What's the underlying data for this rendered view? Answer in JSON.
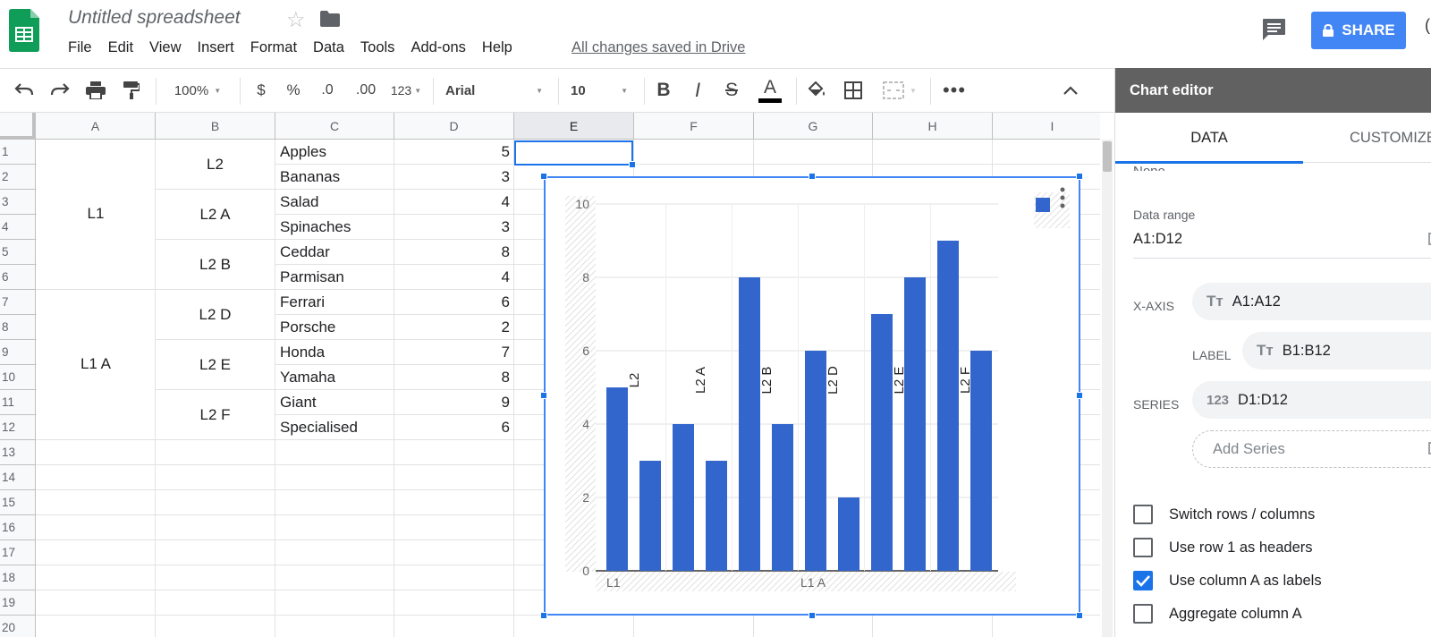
{
  "header": {
    "doc_title": "Untitled spreadsheet",
    "menu": [
      "File",
      "Edit",
      "View",
      "Insert",
      "Format",
      "Data",
      "Tools",
      "Add-ons",
      "Help"
    ],
    "saved_status": "All changes saved in Drive",
    "share_label": "SHARE"
  },
  "toolbar": {
    "zoom": "100%",
    "currency": "$",
    "percent": "%",
    "decrease_decimals": ".0",
    "increase_decimals": ".00",
    "more_formats": "123",
    "font": "Arial",
    "font_size": "10",
    "bold": "B",
    "italic": "I",
    "strikethrough": "S",
    "text_color": "A"
  },
  "grid": {
    "columns": [
      "A",
      "B",
      "C",
      "D",
      "E",
      "F",
      "G",
      "H",
      "I"
    ],
    "rows": [
      "1",
      "2",
      "3",
      "4",
      "5",
      "6",
      "7",
      "8",
      "9",
      "10",
      "11",
      "12",
      "13",
      "14",
      "15",
      "16",
      "17",
      "18",
      "19",
      "20"
    ],
    "col_a_groups": [
      "L1",
      "L1 A"
    ],
    "col_b_groups": [
      "L2",
      "L2 A",
      "L2 B",
      "L2 D",
      "L2 E",
      "L2 F"
    ],
    "col_c": [
      "Apples",
      "Bananas",
      "Salad",
      "Spinaches",
      "Ceddar",
      "Parmisan",
      "Ferrari",
      "Porsche",
      "Honda",
      "Yamaha",
      "Giant",
      "Specialised"
    ],
    "col_d": [
      "5",
      "3",
      "4",
      "3",
      "8",
      "4",
      "6",
      "2",
      "7",
      "8",
      "9",
      "6"
    ]
  },
  "chart_data": {
    "type": "bar",
    "categories": [
      "Apples",
      "Bananas",
      "Salad",
      "Spinaches",
      "Ceddar",
      "Parmisan",
      "Ferrari",
      "Porsche",
      "Honda",
      "Yamaha",
      "Giant",
      "Specialised"
    ],
    "series": [
      {
        "values": [
          5,
          3,
          4,
          3,
          8,
          4,
          6,
          2,
          7,
          8,
          9,
          6
        ]
      }
    ],
    "group_labels": [
      "L2",
      "L2 A",
      "L2 B",
      "L2 D",
      "L2 E",
      "L2 F"
    ],
    "axis_groups": [
      "L1",
      "L1 A"
    ],
    "yticks": [
      "0",
      "2",
      "4",
      "6",
      "8",
      "10"
    ],
    "ylim": [
      0,
      10
    ],
    "bar_color": "#3366cc",
    "grid": true,
    "legend_position": "top-right"
  },
  "chart_editor": {
    "title": "Chart editor",
    "tabs": [
      "DATA",
      "CUSTOMIZE"
    ],
    "cut_text": "None",
    "data_range_label": "Data range",
    "data_range_value": "A1:D12",
    "x_axis_label": "X-AXIS",
    "x_axis_value": "A1:A12",
    "label_label": "LABEL",
    "label_value": "B1:B12",
    "series_label": "SERIES",
    "series_value": "D1:D12",
    "add_series": "Add Series",
    "checkboxes": [
      {
        "label": "Switch rows / columns",
        "checked": false
      },
      {
        "label": "Use row 1 as headers",
        "checked": false
      },
      {
        "label": "Use column A as labels",
        "checked": true
      },
      {
        "label": "Aggregate column A",
        "checked": false
      }
    ]
  },
  "colors": {
    "accent": "#1a73e8",
    "share": "#4285f4",
    "sheets_green": "#0f9d58"
  }
}
